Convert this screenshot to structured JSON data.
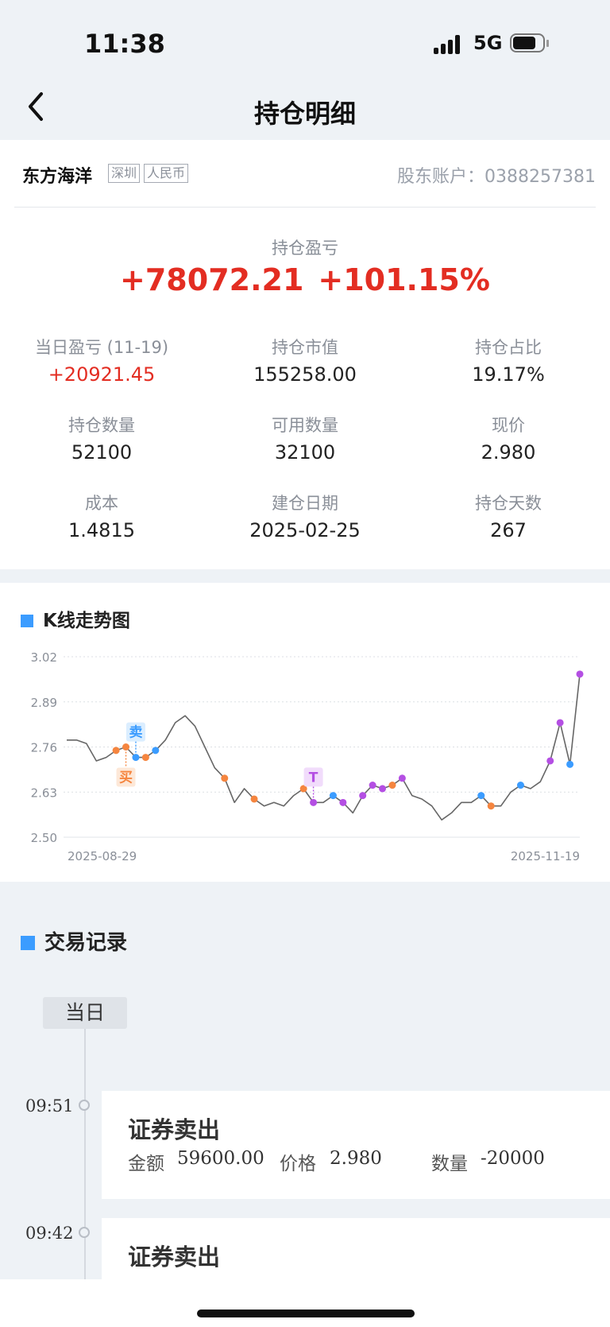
{
  "status": {
    "time": "11:38",
    "network": "5G"
  },
  "nav": {
    "title": "持仓明细"
  },
  "stock": {
    "name": "东方海洋",
    "tags": [
      "深圳",
      "人民币"
    ],
    "account_label": "股东账户：",
    "account_number": "0388257381"
  },
  "pl": {
    "label": "持仓盈亏",
    "amount": "+78072.21",
    "percent": "+101.15%"
  },
  "metrics": [
    {
      "label": "当日盈亏 (11-19)",
      "value": "+20921.45",
      "highlight": true
    },
    {
      "label": "持仓市值",
      "value": "155258.00"
    },
    {
      "label": "持仓占比",
      "value": "19.17%"
    },
    {
      "label": "持仓数量",
      "value": "52100"
    },
    {
      "label": "可用数量",
      "value": "32100"
    },
    {
      "label": "现价",
      "value": "2.980"
    },
    {
      "label": "成本",
      "value": "1.4815"
    },
    {
      "label": "建仓日期",
      "value": "2025-02-25"
    },
    {
      "label": "持仓天数",
      "value": "267"
    }
  ],
  "chart_section": {
    "title": "K线走势图"
  },
  "chart_data": {
    "type": "line",
    "x_start_label": "2025-08-29",
    "x_end_label": "2025-11-19",
    "y_ticks": [
      "3.02",
      "2.89",
      "2.76",
      "2.63",
      "2.50"
    ],
    "ylim": [
      2.5,
      3.02
    ],
    "grid": true,
    "values": [
      2.78,
      2.78,
      2.77,
      2.72,
      2.73,
      2.75,
      2.76,
      2.73,
      2.73,
      2.75,
      2.78,
      2.83,
      2.85,
      2.82,
      2.76,
      2.7,
      2.67,
      2.6,
      2.64,
      2.61,
      2.59,
      2.6,
      2.59,
      2.62,
      2.64,
      2.6,
      2.6,
      2.62,
      2.6,
      2.57,
      2.62,
      2.65,
      2.64,
      2.65,
      2.67,
      2.62,
      2.61,
      2.59,
      2.55,
      2.57,
      2.6,
      2.6,
      2.62,
      2.59,
      2.59,
      2.63,
      2.65,
      2.64,
      2.66,
      2.72,
      2.83,
      2.71,
      2.97
    ],
    "colors": {
      "line": "#666666",
      "buy": "#f5853f",
      "sell": "#3b9cff",
      "t": "#b44fe3"
    },
    "markers": [
      {
        "i": 5,
        "type": "buy"
      },
      {
        "i": 6,
        "type": "buy"
      },
      {
        "i": 7,
        "type": "sell"
      },
      {
        "i": 8,
        "type": "buy"
      },
      {
        "i": 9,
        "type": "sell"
      },
      {
        "i": 16,
        "type": "buy"
      },
      {
        "i": 19,
        "type": "buy"
      },
      {
        "i": 24,
        "type": "buy"
      },
      {
        "i": 25,
        "type": "t"
      },
      {
        "i": 27,
        "type": "sell"
      },
      {
        "i": 28,
        "type": "t"
      },
      {
        "i": 30,
        "type": "t"
      },
      {
        "i": 31,
        "type": "t"
      },
      {
        "i": 32,
        "type": "t"
      },
      {
        "i": 33,
        "type": "buy"
      },
      {
        "i": 34,
        "type": "t"
      },
      {
        "i": 42,
        "type": "sell"
      },
      {
        "i": 43,
        "type": "buy"
      },
      {
        "i": 46,
        "type": "sell"
      },
      {
        "i": 49,
        "type": "t"
      },
      {
        "i": 50,
        "type": "t"
      },
      {
        "i": 51,
        "type": "sell"
      },
      {
        "i": 52,
        "type": "t"
      }
    ],
    "labels": [
      {
        "i": 6,
        "text": "买",
        "type": "buy",
        "pos": "below"
      },
      {
        "i": 7,
        "text": "卖",
        "type": "sell",
        "pos": "above"
      },
      {
        "i": 25,
        "text": "T",
        "type": "t",
        "pos": "above"
      }
    ]
  },
  "trades_section": {
    "title": "交易记录",
    "today_label": "当日"
  },
  "trades": [
    {
      "time": "09:51",
      "title": "证券卖出",
      "amount_label": "金额",
      "amount": "59600.00",
      "price_label": "价格",
      "price": "2.980",
      "qty_label": "数量",
      "qty": "-20000"
    },
    {
      "time": "09:42",
      "title": "证券卖出"
    }
  ]
}
